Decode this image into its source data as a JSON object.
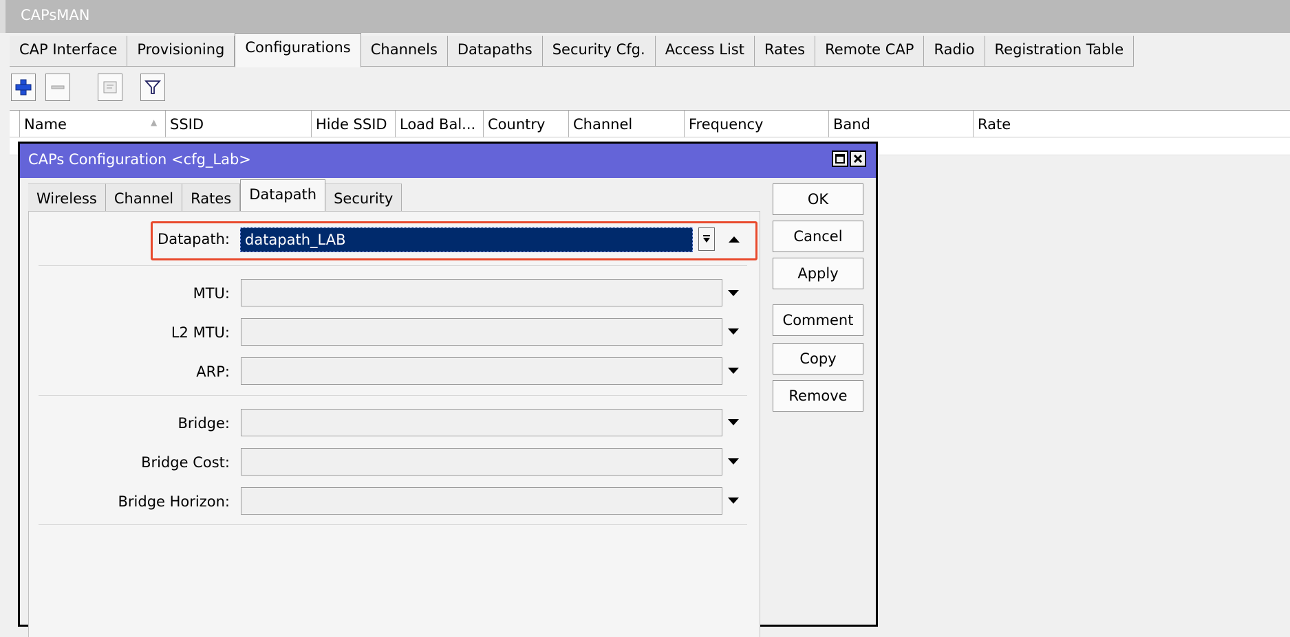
{
  "window": {
    "title": "CAPsMAN"
  },
  "main_tabs": [
    {
      "label": "CAP Interface"
    },
    {
      "label": "Provisioning"
    },
    {
      "label": "Configurations"
    },
    {
      "label": "Channels"
    },
    {
      "label": "Datapaths"
    },
    {
      "label": "Security Cfg."
    },
    {
      "label": "Access List"
    },
    {
      "label": "Rates"
    },
    {
      "label": "Remote CAP"
    },
    {
      "label": "Radio"
    },
    {
      "label": "Registration Table"
    }
  ],
  "toolbar": {
    "add_icon": "plus-icon",
    "remove_icon": "minus-icon",
    "comment_icon": "note-icon",
    "filter_icon": "filter-icon"
  },
  "table": {
    "columns": [
      "Name",
      "SSID",
      "Hide SSID",
      "Load Bal...",
      "Country",
      "Channel",
      "Frequency",
      "Band",
      "Rate"
    ],
    "sort_indicator": "▲"
  },
  "dialog": {
    "title": "CAPs Configuration <cfg_Lab>",
    "tabs": [
      {
        "label": "Wireless"
      },
      {
        "label": "Channel"
      },
      {
        "label": "Rates"
      },
      {
        "label": "Datapath"
      },
      {
        "label": "Security"
      }
    ],
    "datapath": {
      "label": "Datapath:",
      "value": "datapath_LAB"
    },
    "fields": {
      "mtu": "MTU:",
      "l2mtu": "L2 MTU:",
      "arp": "ARP:",
      "bridge": "Bridge:",
      "bridge_cost": "Bridge Cost:",
      "bridge_horizon": "Bridge Horizon:"
    },
    "buttons": {
      "ok": "OK",
      "cancel": "Cancel",
      "apply": "Apply",
      "comment": "Comment",
      "copy": "Copy",
      "remove": "Remove"
    }
  },
  "colors": {
    "title_bar": "#6464d8",
    "highlight": "#e8492c",
    "selected_value_bg": "#002a6c"
  }
}
